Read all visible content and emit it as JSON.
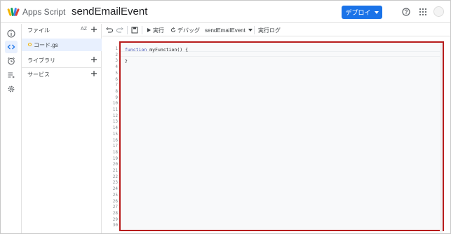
{
  "header": {
    "app_name": "Apps Script",
    "project_title": "sendEmailEvent",
    "deploy_label": "デプロイ"
  },
  "files_panel": {
    "title": "ファイル",
    "sort_label": "AZ",
    "files": [
      {
        "name": "コード.gs"
      }
    ],
    "libraries_label": "ライブラリ",
    "services_label": "サービス"
  },
  "toolbar": {
    "run_label": "実行",
    "debug_label": "デバッグ",
    "function_selected": "sendEmailEvent",
    "exec_log_label": "実行ログ"
  },
  "editor": {
    "code_lines": [
      {
        "keyword": "function",
        "rest": " myFunction() {"
      },
      {
        "keyword": "",
        "rest": ""
      },
      {
        "keyword": "",
        "rest": "}"
      }
    ],
    "line_numbers": [
      "1",
      "2",
      "3",
      "4",
      "5",
      "6",
      "7",
      "8",
      "9",
      "10",
      "11",
      "12",
      "13",
      "14",
      "15",
      "16",
      "17",
      "18",
      "19",
      "20",
      "21",
      "22",
      "23",
      "24",
      "25",
      "26",
      "27",
      "28",
      "29",
      "30"
    ]
  },
  "colors": {
    "accent": "#1a73e8",
    "highlight_box": "#b71c1c",
    "active_bg": "#e8f0fe"
  },
  "icons": {
    "rail": [
      "info-icon",
      "code-icon",
      "alarm-icon",
      "executions-icon",
      "settings-icon"
    ],
    "top": [
      "help-icon",
      "apps-grid-icon"
    ]
  }
}
